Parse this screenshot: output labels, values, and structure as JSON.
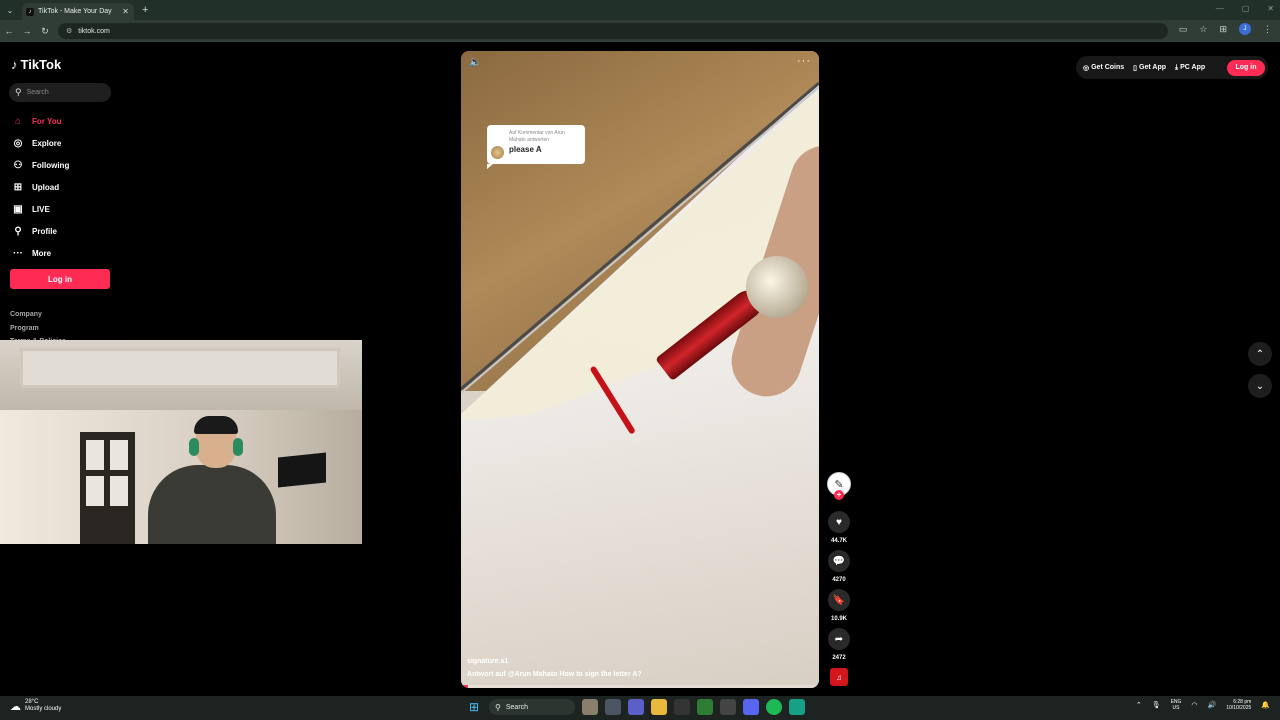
{
  "browser": {
    "tab_title": "TikTok - Make Your Day",
    "tab_favicon": "♪",
    "close_symbol": "✕",
    "new_tab_symbol": "+",
    "url": "tiktok.com",
    "profile_initial": "J",
    "icons": {
      "back": "←",
      "forward": "→",
      "reload": "↻",
      "cast": "▭",
      "star": "☆",
      "menu": "⋮",
      "extensions": "⊞",
      "tab_list": "⌄",
      "site_info": "⚙",
      "minimize": "—",
      "maximize": "▢"
    }
  },
  "sidebar": {
    "logo_text": "TikTok",
    "logo_icon": "♪",
    "search_placeholder": "Search",
    "nav_items": [
      {
        "label": "For You",
        "icon": "⌂",
        "active": true
      },
      {
        "label": "Explore",
        "icon": "◎"
      },
      {
        "label": "Following",
        "icon": "⚇"
      },
      {
        "label": "Upload",
        "icon": "⊞"
      },
      {
        "label": "LIVE",
        "icon": "▣"
      },
      {
        "label": "Profile",
        "icon": "⚲"
      },
      {
        "label": "More",
        "icon": "···"
      }
    ],
    "login_label": "Log in",
    "footer_links": [
      "Company",
      "Program",
      "Terms & Policies"
    ]
  },
  "video": {
    "reply_sub": "Auf Kommentar von Arun Mahato antworten",
    "reply_text": "please A",
    "author": "signature.s1",
    "caption": "Antwort auf @Arun Mahato  How to sign the letter A?",
    "progress_percent": 2,
    "icons": {
      "mute": "🔈",
      "more": "···"
    }
  },
  "actions": {
    "likes": "44.7K",
    "comments": "4270",
    "saves": "10.9K",
    "shares": "2472",
    "icons": {
      "like": "♥",
      "comment": "💬",
      "save": "🔖",
      "share": "➦",
      "follow": "+",
      "creator": "✎",
      "music": "♫"
    }
  },
  "top_actions": {
    "get_coins": "Get Coins",
    "get_app": "Get App",
    "pc_app": "PC App",
    "login": "Log in",
    "icons": {
      "coins": "◎",
      "app": "▯",
      "pc": "⤓"
    }
  },
  "nav_arrows": {
    "up": "⌃",
    "down": "⌄"
  },
  "taskbar": {
    "temperature": "28°C",
    "weather": "Mostly cloudy",
    "search_label": "Search",
    "language": "ENG",
    "region": "US",
    "time": "6:28 pm",
    "date": "10/10/2025",
    "icons": {
      "weather": "☁",
      "windows": "⊞",
      "search": "⚲",
      "tray_up": "⌃",
      "mic": "🎙",
      "wifi": "◠",
      "volume": "🔊",
      "bell": "🔔"
    }
  }
}
